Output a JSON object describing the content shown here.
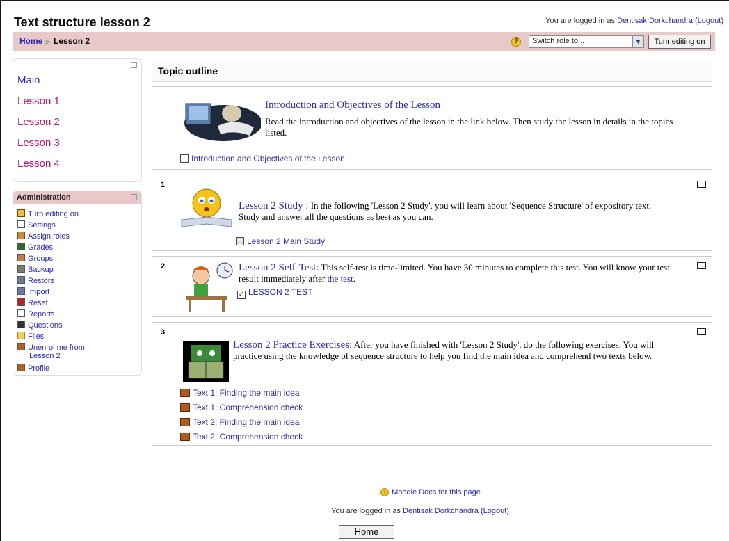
{
  "header": {
    "title": "Text structure lesson 2",
    "logged_prefix": "You are logged in as",
    "user": "Dentisak Dorkchandra",
    "logout": "(Logout)"
  },
  "breadcrumb": {
    "home": "Home",
    "current": "Lesson 2"
  },
  "controls": {
    "help": "?",
    "switch_role": "Switch role to...",
    "edit_button": "Turn editing on"
  },
  "sections_block": {
    "items": [
      {
        "label": "Main"
      },
      {
        "label": "Lesson 1"
      },
      {
        "label": "Lesson 2"
      },
      {
        "label": "Lesson 3"
      },
      {
        "label": "Lesson 4"
      }
    ]
  },
  "admin": {
    "title": "Administration",
    "items": [
      {
        "label": "Turn editing on",
        "icon": "edit-icon"
      },
      {
        "label": "Settings",
        "icon": "settings-icon"
      },
      {
        "label": "Assign roles",
        "icon": "roles-icon"
      },
      {
        "label": "Grades",
        "icon": "grades-icon"
      },
      {
        "label": "Groups",
        "icon": "groups-icon"
      },
      {
        "label": "Backup",
        "icon": "backup-icon"
      },
      {
        "label": "Restore",
        "icon": "restore-icon"
      },
      {
        "label": "Import",
        "icon": "import-icon"
      },
      {
        "label": "Reset",
        "icon": "reset-icon"
      },
      {
        "label": "Reports",
        "icon": "reports-icon"
      },
      {
        "label": "Questions",
        "icon": "questions-icon"
      },
      {
        "label": "Files",
        "icon": "folder-icon"
      },
      {
        "label": "Unenrol me from",
        "label2": "Lesson 2",
        "icon": "unenrol-icon"
      },
      {
        "label": "Profile",
        "icon": "profile-icon"
      }
    ]
  },
  "main": {
    "heading": "Topic outline",
    "intro": {
      "title": "Introduction and Objectives of the Lesson",
      "text": "Read the introduction and objectives of the lesson in the link below. Then study the lesson in details in the topics listed.",
      "link": "Introduction and Objectives of the Lesson"
    },
    "sections": [
      {
        "num": "1",
        "title": "Lesson 2 Study :",
        "text": " In the following 'Lesson 2 Study', you will learn about 'Sequence Structure' of expository text. Study and answer all the questions as best as you can.",
        "link": "Lesson 2 Main Study"
      },
      {
        "num": "2",
        "title": "Lesson 2 Self-Test:",
        "text": " This self-test is time-limited. You have 30 minutes to complete this test. You will know your test result immediately after ",
        "text_link": "the test",
        "text_end": ".",
        "link": "LESSON 2 TEST"
      },
      {
        "num": "3",
        "title": "Lesson 2 Practice Exercises:",
        "text": " After you have finished with 'Lesson 2 Study', do the following exercises. You will practice using the knowledge of sequence structure to help you find the main idea and comprehend two texts below.",
        "links": [
          "Text 1: Finding the main idea",
          "Text 1: Comprehension check",
          "Text 2: Finding the main idea",
          "Text 2: Comprehension check"
        ]
      }
    ]
  },
  "footer": {
    "docs": "Moodle Docs for this page",
    "logged_prefix": "You are logged in as",
    "user": "Dentisak Dorkchandra",
    "logout": "(Logout)",
    "home_button": "Home"
  }
}
